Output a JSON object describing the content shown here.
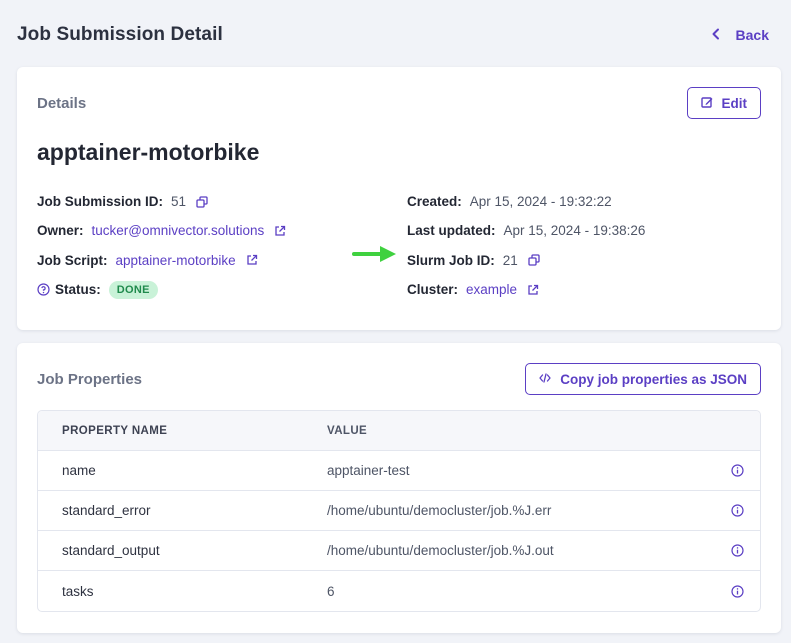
{
  "page": {
    "title": "Job Submission Detail",
    "back_label": "Back"
  },
  "details": {
    "label": "Details",
    "edit_label": "Edit",
    "job_name": "apptainer-motorbike",
    "left_fields": [
      {
        "label": "Job Submission ID:",
        "value": "51"
      },
      {
        "label": "Owner:",
        "value": "tucker@omnivector.solutions"
      },
      {
        "label": "Job Script:",
        "value": "apptainer-motorbike"
      },
      {
        "label": "Status:",
        "value": "DONE"
      }
    ],
    "right_fields": [
      {
        "label": "Created:",
        "value": "Apr 15, 2024 - 19:32:22"
      },
      {
        "label": "Last updated:",
        "value": "Apr 15, 2024 - 19:38:26"
      },
      {
        "label": "Slurm Job ID:",
        "value": "21"
      },
      {
        "label": "Cluster:",
        "value": "example"
      }
    ]
  },
  "properties": {
    "label": "Job Properties",
    "copy_label": "Copy job properties as JSON",
    "columns": [
      "PROPERTY NAME",
      "VALUE"
    ],
    "rows": [
      {
        "name": "name",
        "value": "apptainer-test"
      },
      {
        "name": "standard_error",
        "value": "/home/ubuntu/democluster/job.%J.err"
      },
      {
        "name": "standard_output",
        "value": "/home/ubuntu/democluster/job.%J.out"
      },
      {
        "name": "tasks",
        "value": "6"
      }
    ]
  },
  "colors": {
    "accent": "#5b3fc4",
    "status_done_bg": "#c9f2d8",
    "status_done_fg": "#1f8a4c",
    "annotation_arrow": "#3fd13f"
  },
  "icons": [
    "chevron-left-icon",
    "edit-icon",
    "copy-icon",
    "external-link-icon",
    "help-circle-icon",
    "code-icon",
    "info-icon",
    "arrow-right-icon"
  ]
}
